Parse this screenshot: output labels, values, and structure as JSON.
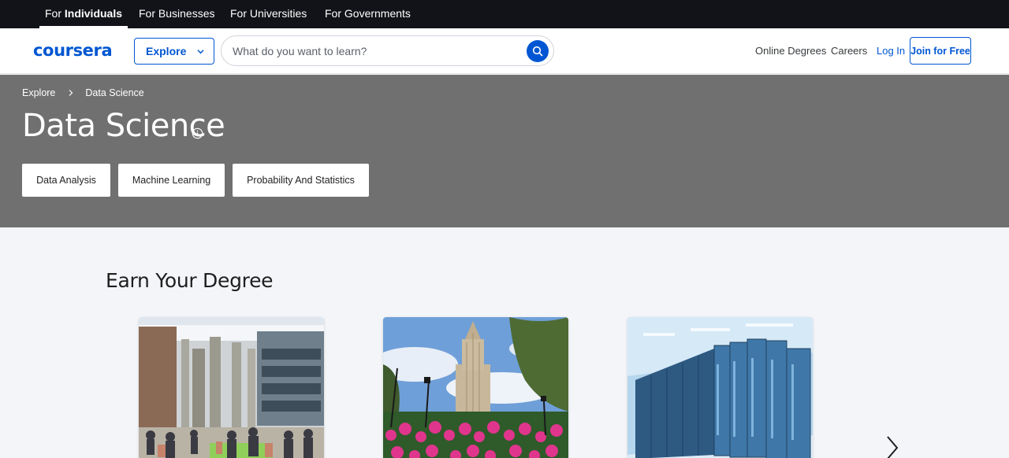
{
  "audience_tabs": [
    {
      "prefix": "For ",
      "label": "Individuals"
    },
    {
      "label": "For Businesses"
    },
    {
      "label": "For Universities"
    },
    {
      "label": "For Governments"
    }
  ],
  "header": {
    "logo": "coursera",
    "explore_label": "Explore",
    "search_placeholder": "What do you want to learn?",
    "links": {
      "online_degrees": "Online Degrees",
      "careers": "Careers",
      "log_in": "Log In"
    },
    "join_label": "Join for Free"
  },
  "hero": {
    "breadcrumb": [
      "Explore",
      "Data Science"
    ],
    "title": "Data Science",
    "chips": [
      "Data Analysis",
      "Machine Learning",
      "Probability And Statistics"
    ]
  },
  "section": {
    "title": "Earn Your Degree"
  },
  "colors": {
    "brand": "#0056d2",
    "top_bar": "#111318",
    "hero_bg": "#707070",
    "page_bg": "#f3f5f9"
  }
}
